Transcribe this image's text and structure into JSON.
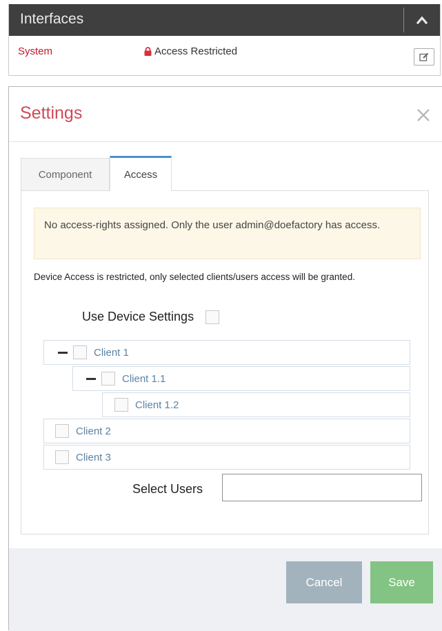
{
  "interfaces": {
    "title": "Interfaces",
    "row": {
      "name": "System",
      "status": "Access Restricted"
    }
  },
  "dialog": {
    "title": "Settings",
    "tabs": [
      {
        "label": "Component",
        "active": false
      },
      {
        "label": "Access",
        "active": true
      }
    ],
    "alert": "No access-rights assigned. Only the user admin@doefactory has access.",
    "description": "Device Access is restricted, only selected clients/users access will be granted.",
    "use_device_settings_label": "Use Device Settings",
    "tree": [
      {
        "label": "Client 1",
        "level": 0,
        "collapsible": true,
        "checked": false
      },
      {
        "label": "Client 1.1",
        "level": 1,
        "collapsible": true,
        "checked": false
      },
      {
        "label": "Client 1.2",
        "level": 2,
        "collapsible": false,
        "checked": false
      },
      {
        "label": "Client 2",
        "level": 0,
        "collapsible": false,
        "checked": false
      },
      {
        "label": "Client 3",
        "level": 0,
        "collapsible": false,
        "checked": false
      }
    ],
    "select_users_label": "Select Users",
    "select_users_value": "",
    "buttons": {
      "cancel": "Cancel",
      "save": "Save"
    }
  },
  "colors": {
    "header_bg": "#3f3f3f",
    "system_red": "#c7162b",
    "dialog_title": "#d04a57",
    "tab_accent": "#4a8fd3",
    "alert_bg": "#fcf7e6",
    "tree_link": "#5b82a5",
    "cancel_bg": "#a3b3bd",
    "save_bg": "#83c383"
  },
  "icons": {
    "collapse": "chevron-up-icon",
    "lock": "lock-icon",
    "edit": "edit-icon",
    "close": "close-icon"
  }
}
